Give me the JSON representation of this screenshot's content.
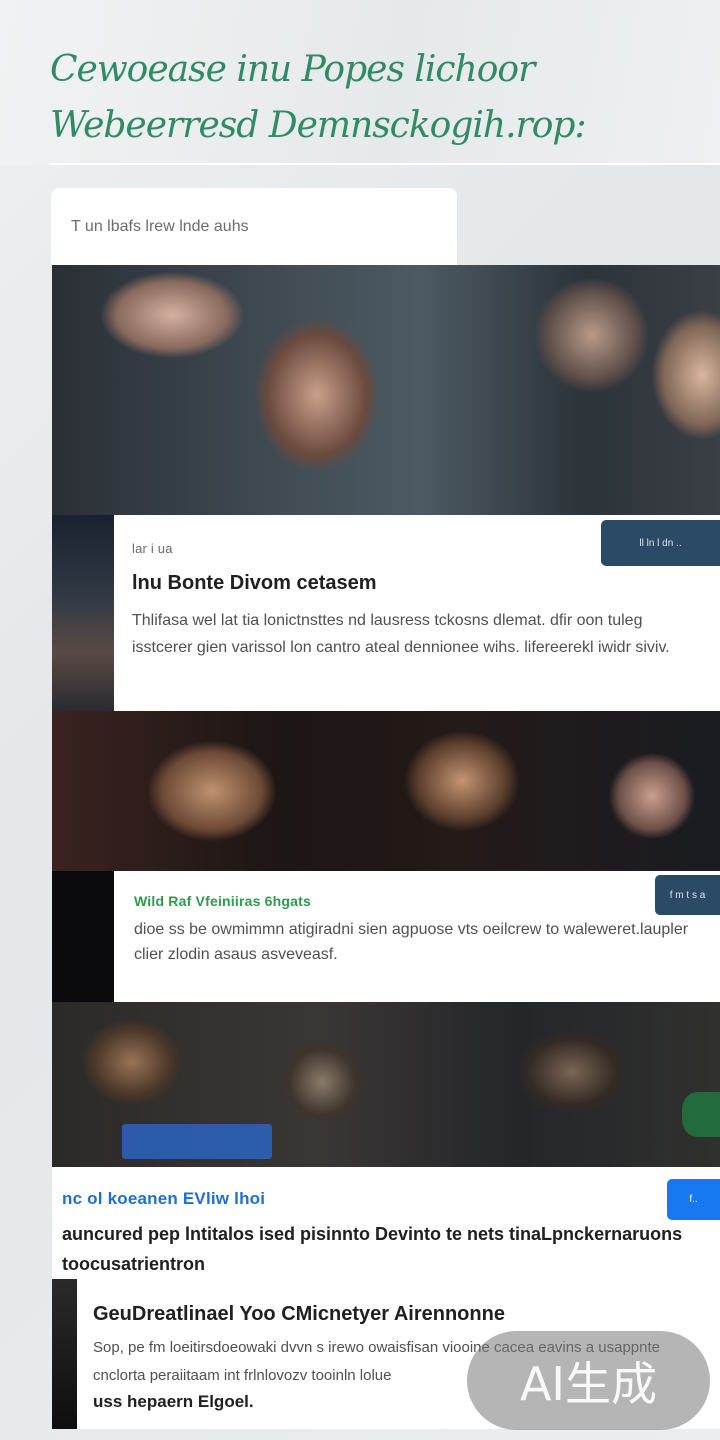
{
  "header": {
    "title_line_1": "Cewoease inu Popes lichoor",
    "title_line_2": "Webeerresd Demnsckogih.rop:"
  },
  "search": {
    "placeholder": "T un lbafs lrew lnde auhs"
  },
  "cards": [
    {
      "tag": "lar i ua",
      "button_label": "ll ln l dn ..",
      "title": "lnu Bonte Divom cetasem",
      "body": "Thlifasa wel lat tia lonictnsttes nd lausress tckosns dlemat. dfir oon tuleg isstcerer gien varissol lon cantro ateal dennionee wihs. lifereerekl iwidr siviv."
    },
    {
      "tag": "Wild Raf Vfeiniiras 6hgats",
      "button_label": "f m t s a",
      "body": "dioe ss be owmimmn atigiradni sien agpuose vts oeilcrew to waleweret.laupler clier zlodin asaus asveveasf."
    },
    {
      "tag": "nc ol koeanen EVliw lhoi",
      "button_label": "f..",
      "title": "auncured pep lntitalos ised pisinnto Devinto te nets tinaLpnckernaruons toocusatrientron"
    },
    {
      "title": "GeuDreatlinael Yoo CMicnetyer Airennonne",
      "body": "Sop, pe fm loeitirsdoeowaki dvvn s irewo owaisfisan viooine cacea eavins a usappnte cnclorta peraiitaam int frlnlovozv tooinln lolue",
      "author": "uss hepaern Elgoel."
    }
  ],
  "watermark": "AI生成"
}
